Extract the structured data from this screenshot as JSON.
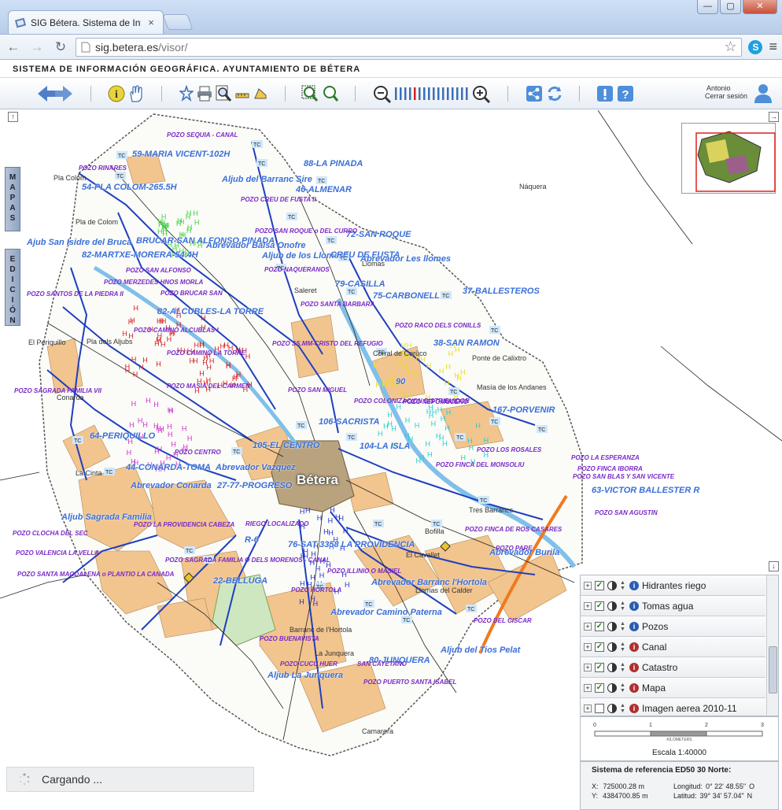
{
  "browser": {
    "tab_title": "SIG Bétera. Sistema de Inform",
    "url_host": "sig.betera.es",
    "url_path": "/visor/",
    "win_minimize": "—",
    "win_maximize": "▢",
    "win_close": "✕"
  },
  "app": {
    "title": "SISTEMA DE INFORMACIÓN GEOGRÁFICA. AYUNTAMIENTO DE BÉTERA",
    "user_name": "Antonio",
    "logout_label": "Cerrar sesión"
  },
  "side_tabs": {
    "mapas": "M A P A S",
    "edicion": "E D I C I Ó N"
  },
  "map_labels": {
    "blue": [
      "59-MARIA VICENT-102H",
      "88-LA PINADA",
      "Aljub del Barranc Sire",
      "46-ALMENAR",
      "54-PLA COLOM-265.5H",
      "72-SAN ROQUE",
      "Ajub San Isidre del Bruca",
      "BRUCAR-SAN ALFONSO PINADA",
      "Abrevador Balsa Onofre",
      "82-MARTXE-MORERA-54.4H",
      "Aljub de los Llomes",
      "CREU DE FUSTA",
      "Abrevador Les llomes",
      "79-CASILLA",
      "75-CARBONELL",
      "37-BALLESTEROS",
      "82-ALCUBLES-LA TORRE",
      "38-SAN RAMON",
      "90",
      "106-SACRISTA",
      "167-PORVENIR",
      "64-PERIQUILLO",
      "105-EL CENTRO",
      "104-LA ISLA",
      "44-CONARDA-TOMA",
      "Abrevador Vazquez",
      "Abrevador Conarda",
      "27-77-PROGRESO",
      "63-VICTOR BALLESTER R",
      "Aljub Sagrada Familia",
      "R-6",
      "76-SAT 3358 LA PROVIDENCIA",
      "Abrevador Burila",
      "22-BELLUGA",
      "Abrevador Barranc l'Hortola",
      "Abrevador Camino Paterna",
      "80-JUNQUERA",
      "Aljub del Tios Pelat",
      "Aljub La Junquera"
    ],
    "pozo": [
      "POZO SEQUIA - CANAL",
      "POZO RINARES",
      "POZO CREU DE FUSTA II",
      "POZO SAN ROQUE o DEL CURRO",
      "POZO SAN ALFONSO",
      "POZO NAQUERANOS",
      "POZO MERZEDES HNOS MORLA",
      "POZO SANTOS DE LA PIEDRA II",
      "POZO BRUCAR SAN",
      "POZO SANTA BARBARA",
      "POZO RACO DELS CONILLS",
      "POZO CAMINO ALCUBLAS I",
      "POZO SS.MM-CRISTO DEL REFUGIO",
      "POZO CAMINO LA TORRE",
      "POZO SAGRADA FAMILIA VII",
      "POZO MASIA DEL CARMEN",
      "POZO SAN MIGUEL",
      "POZO COLONIZACION DISTRIBUIDOR",
      "POZO NEPOMUCENO",
      "POZO CENTRO",
      "POZO FINCA DEL MONSOLIU",
      "POZO LOS ROSALES",
      "POZO LA ESPERANZA",
      "POZO FINCA IBORRA",
      "POZO SAN BLAS Y SAN VICENTE",
      "POZO SAN AGUSTIN",
      "POZO LA PROVIDENCIA CABEZA",
      "RIEGO LOCALIZADO",
      "POZO CLOCHA DEL SEC",
      "POZO FINCA DE ROS CASARES",
      "POZO VALENCIA LA VELLA",
      "POZO SAGRADA FAMILIA O DELS MORENOS - CANAL",
      "POZO PARE",
      "POZO SANTA MAGDALENA o PLANTIO LA CANADA",
      "POZO ILLINIO O MASIEL",
      "POZO HORTOLA",
      "POZO DEL CISCAR",
      "POZO BUENAVISTA",
      "POZO CUCU HUER",
      "SAN CAYETANO",
      "POZO PUERTO SANTA ISABEL"
    ],
    "towns": [
      "Náquera",
      "Pla Colom",
      "Pla de Colom",
      "Llomas",
      "Saleret",
      "El Periquillo",
      "Pla dels Aljubs",
      "Conarda",
      "La Cinta",
      "Bofilla",
      "El Cavallet",
      "Tres Barrancs",
      "Llomas del Calder",
      "Barranc de l'Hortola",
      "La Junquera",
      "Camarera",
      "Corral de Corüco",
      "Ponte de Calixtro",
      "Masía de los Andanes"
    ],
    "main_town": "Bétera"
  },
  "layers": [
    {
      "name": "Hidrantes riego",
      "checked": true,
      "info": "blue"
    },
    {
      "name": "Tomas agua",
      "checked": true,
      "info": "blue"
    },
    {
      "name": "Pozos",
      "checked": true,
      "info": "blue"
    },
    {
      "name": "Canal",
      "checked": true,
      "info": "red"
    },
    {
      "name": "Catastro",
      "checked": true,
      "info": "red"
    },
    {
      "name": "Mapa",
      "checked": true,
      "info": "red"
    },
    {
      "name": "Imagen aerea 2010-11",
      "checked": false,
      "info": "red"
    }
  ],
  "scale": {
    "ticks": [
      "0",
      "1",
      "2",
      "3"
    ],
    "unit": "KILOMETERS",
    "label": "Escala 1:40000"
  },
  "coords": {
    "header": "Sistema de referencia ED50 30 Norte:",
    "x_label": "X:",
    "x_value": "725000.28 m",
    "y_label": "Y:",
    "y_value": "4384700.85 m",
    "lon_label": "Longitud:",
    "lon_value": "0° 22' 48.55\"",
    "lon_dir": "O",
    "lat_label": "Latitud:",
    "lat_value": "39° 34' 57.04\"",
    "lat_dir": "N"
  },
  "status": {
    "loading_text": "Cargando ..."
  }
}
